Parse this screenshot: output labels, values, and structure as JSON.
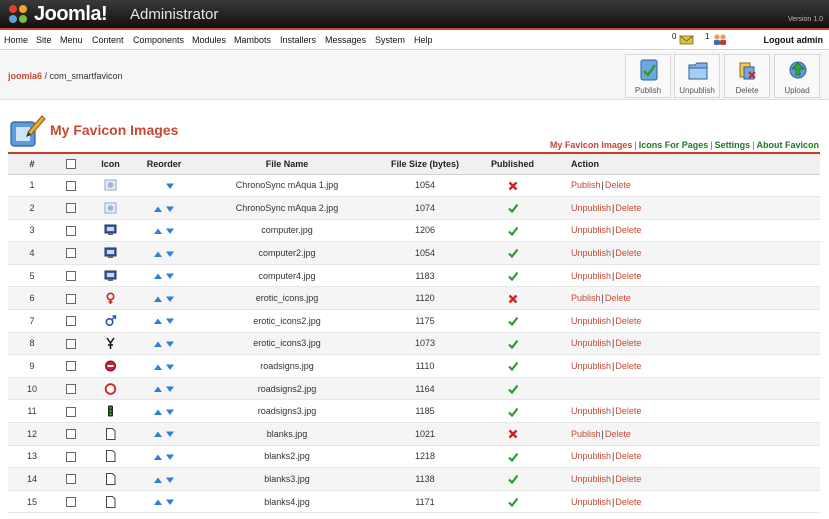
{
  "header": {
    "brand": "Joomla!",
    "subtitle": "Administrator",
    "version": "Version 1.0"
  },
  "menu": {
    "items": [
      "Home",
      "Site",
      "Menu",
      "Content",
      "Components",
      "Modules",
      "Mambots",
      "Installers",
      "Messages",
      "System",
      "Help"
    ],
    "messages_count": "0",
    "users_count": "1",
    "logout": "Logout admin"
  },
  "breadcrumb": {
    "home": "joomla6",
    "separator": " / ",
    "current": "com_smartfavicon"
  },
  "toolbar": {
    "buttons": [
      {
        "label": "Publish",
        "icon": "publish-icon"
      },
      {
        "label": "Unpublish",
        "icon": "unpublish-icon"
      },
      {
        "label": "Delete",
        "icon": "delete-icon"
      },
      {
        "label": "Upload",
        "icon": "upload-icon"
      }
    ]
  },
  "page": {
    "title": "My Favicon Images"
  },
  "submenu": {
    "items": [
      "My Favicon Images",
      "Icons For Pages",
      "Settings",
      "About Favicon"
    ],
    "separator": "|"
  },
  "table": {
    "headers": [
      "#",
      "Icon",
      "Reorder",
      "File Name",
      "File Size (bytes)",
      "Published",
      "Action"
    ],
    "rows": [
      {
        "num": "1",
        "icon": "chronosync-icon",
        "file": "ChronoSync mAqua 1.jpg",
        "size": "1054",
        "published": false,
        "action1": "Publish",
        "action2": "Delete",
        "up": false,
        "down": true
      },
      {
        "num": "2",
        "icon": "chronosync-icon",
        "file": "ChronoSync mAqua 2.jpg",
        "size": "1074",
        "published": true,
        "action1": "Unpublish",
        "action2": "Delete",
        "up": true,
        "down": true
      },
      {
        "num": "3",
        "icon": "computer-icon",
        "file": "computer.jpg",
        "size": "1206",
        "published": true,
        "action1": "Unpublish",
        "action2": "Delete",
        "up": true,
        "down": true
      },
      {
        "num": "4",
        "icon": "computer-icon",
        "file": "computer2.jpg",
        "size": "1054",
        "published": true,
        "action1": "Unpublish",
        "action2": "Delete",
        "up": true,
        "down": true
      },
      {
        "num": "5",
        "icon": "computer-icon",
        "file": "computer4.jpg",
        "size": "1183",
        "published": true,
        "action1": "Unpublish",
        "action2": "Delete",
        "up": true,
        "down": true
      },
      {
        "num": "6",
        "icon": "female-symbol-icon",
        "file": "erotic_icons.jpg",
        "size": "1120",
        "published": false,
        "action1": "Publish",
        "action2": "Delete",
        "up": true,
        "down": true
      },
      {
        "num": "7",
        "icon": "male-symbol-icon",
        "file": "erotic_icons2.jpg",
        "size": "1175",
        "published": true,
        "action1": "Unpublish",
        "action2": "Delete",
        "up": true,
        "down": true
      },
      {
        "num": "8",
        "icon": "symbol-icon",
        "file": "erotic_icons3.jpg",
        "size": "1073",
        "published": true,
        "action1": "Unpublish",
        "action2": "Delete",
        "up": true,
        "down": true
      },
      {
        "num": "9",
        "icon": "stop-sign-icon",
        "file": "roadsigns.jpg",
        "size": "1110",
        "published": true,
        "action1": "Unpublish",
        "action2": "Delete",
        "up": true,
        "down": true
      },
      {
        "num": "10",
        "icon": "round-sign-icon",
        "file": "roadsigns2.jpg",
        "size": "1164",
        "published": true,
        "action1": "",
        "action2": "",
        "up": true,
        "down": true
      },
      {
        "num": "11",
        "icon": "traffic-light-icon",
        "file": "roadsigns3.jpg",
        "size": "1185",
        "published": true,
        "action1": "Unpublish",
        "action2": "Delete",
        "up": true,
        "down": true
      },
      {
        "num": "12",
        "icon": "blank-page-icon",
        "file": "blanks.jpg",
        "size": "1021",
        "published": false,
        "action1": "Publish",
        "action2": "Delete",
        "up": true,
        "down": true
      },
      {
        "num": "13",
        "icon": "blank-page-icon",
        "file": "blanks2.jpg",
        "size": "1218",
        "published": true,
        "action1": "Unpublish",
        "action2": "Delete",
        "up": true,
        "down": true
      },
      {
        "num": "14",
        "icon": "blank-page-icon",
        "file": "blanks3.jpg",
        "size": "1138",
        "published": true,
        "action1": "Unpublish",
        "action2": "Delete",
        "up": true,
        "down": true
      },
      {
        "num": "15",
        "icon": "blank-page-icon",
        "file": "blanks4.jpg",
        "size": "1171",
        "published": true,
        "action1": "Unpublish",
        "action2": "Delete",
        "up": true,
        "down": true
      }
    ]
  },
  "colors": {
    "accent": "#c64934",
    "link_green": "#1f7a1f",
    "check_green": "#2e9a2e",
    "cross_red": "#d02020",
    "arrow_blue": "#2f7fd6"
  }
}
